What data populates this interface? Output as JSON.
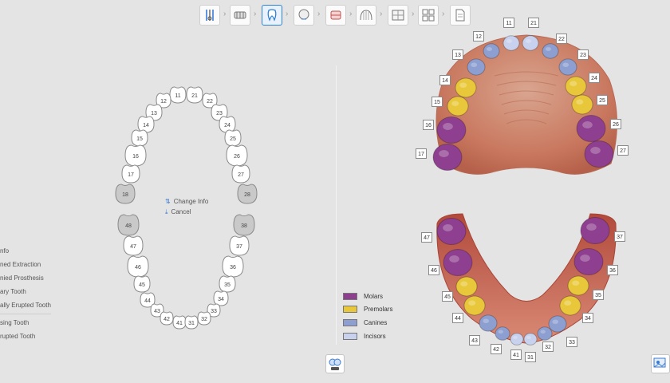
{
  "toolbar": {
    "steps": [
      {
        "icon": "tools-icon",
        "active": false
      },
      {
        "icon": "scan-arch-icon",
        "active": false
      },
      {
        "icon": "tooth-select-icon",
        "active": true
      },
      {
        "icon": "face-scan-icon",
        "active": false
      },
      {
        "icon": "bite-icon",
        "active": false
      },
      {
        "icon": "arch-grid-icon",
        "active": false
      },
      {
        "icon": "ortho-grid-icon",
        "active": false
      },
      {
        "icon": "quad-view-icon",
        "active": false
      },
      {
        "icon": "document-icon",
        "active": false
      }
    ]
  },
  "context_menu": {
    "change_info": "Change Info",
    "cancel": "Cancel"
  },
  "side_list": {
    "items": [
      "nfo",
      "ned Extraction",
      "nied Prosthesis",
      "ary Tooth",
      "ally Erupted Tooth",
      "sing Tooth",
      "rupted Tooth"
    ]
  },
  "tooth_chart": {
    "upper": [
      "11",
      "21",
      "12",
      "22",
      "13",
      "23",
      "14",
      "24",
      "15",
      "25",
      "16",
      "26",
      "17",
      "27",
      "18",
      "28"
    ],
    "lower": [
      "48",
      "38",
      "47",
      "37",
      "46",
      "36",
      "45",
      "35",
      "44",
      "34",
      "43",
      "33",
      "42",
      "32",
      "41",
      "31"
    ],
    "missing": [
      "18",
      "28",
      "48",
      "38"
    ]
  },
  "legend": {
    "items": [
      {
        "label": "Molars",
        "color": "#8e3f8f"
      },
      {
        "label": "Premolars",
        "color": "#e8c83a"
      },
      {
        "label": "Canines",
        "color": "#8c9fd0"
      },
      {
        "label": "Incisors",
        "color": "#c8d2ee"
      }
    ]
  },
  "scan_labels": {
    "upper": [
      "11",
      "21",
      "12",
      "22",
      "13",
      "23",
      "14",
      "24",
      "15",
      "25",
      "16",
      "26",
      "17",
      "27"
    ],
    "lower": [
      "47",
      "37",
      "46",
      "36",
      "45",
      "35",
      "44",
      "34",
      "43",
      "33",
      "42",
      "32",
      "41",
      "31"
    ]
  },
  "colors": {
    "molar": "#8e3f8f",
    "premolar": "#e8c83a",
    "canine": "#8c9fd0",
    "incisor": "#c8d2ee",
    "gum": "#d48a73",
    "accent": "#2f7fd6"
  }
}
